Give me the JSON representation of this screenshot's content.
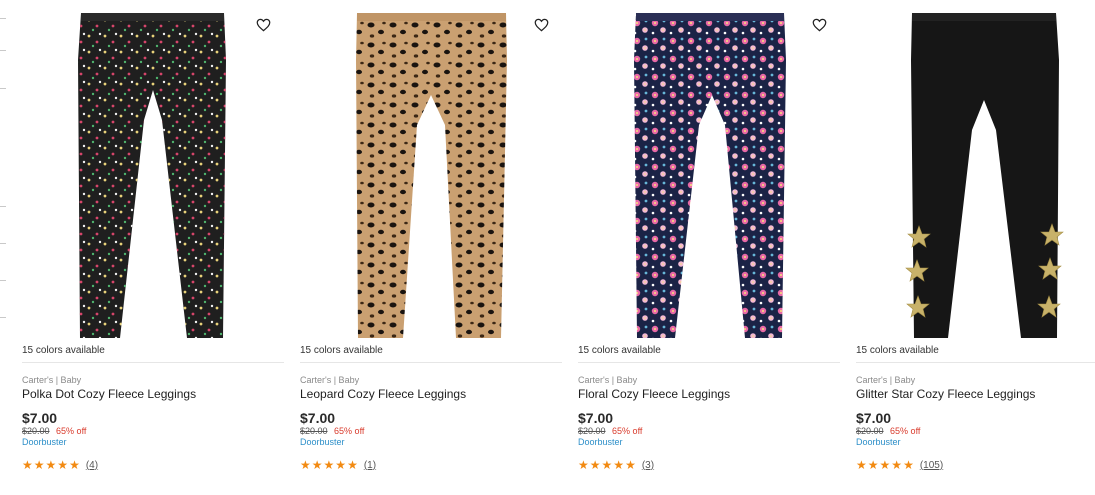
{
  "products": [
    {
      "colors_available": "15 colors available",
      "brand": "Carter's | Baby",
      "title": "Polka Dot Cozy Fleece Leggings",
      "price": "$7.00",
      "original_price": "$20.00",
      "discount": "65% off",
      "badge": "Doorbuster",
      "rating": 5,
      "review_count": "(4)",
      "favorite_icon": "heart-outline-icon"
    },
    {
      "colors_available": "15 colors available",
      "brand": "Carter's | Baby",
      "title": "Leopard Cozy Fleece Leggings",
      "price": "$7.00",
      "original_price": "$20.00",
      "discount": "65% off",
      "badge": "Doorbuster",
      "rating": 5,
      "review_count": "(1)",
      "favorite_icon": "heart-outline-icon"
    },
    {
      "colors_available": "15 colors available",
      "brand": "Carter's | Baby",
      "title": "Floral Cozy Fleece Leggings",
      "price": "$7.00",
      "original_price": "$20.00",
      "discount": "65% off",
      "badge": "Doorbuster",
      "rating": 5,
      "review_count": "(3)",
      "favorite_icon": "heart-outline-icon"
    },
    {
      "colors_available": "15 colors available",
      "brand": "Carter's | Baby",
      "title": "Glitter Star Cozy Fleece Leggings",
      "price": "$7.00",
      "original_price": "$20.00",
      "discount": "65% off",
      "badge": "Doorbuster",
      "rating": 5,
      "review_count": "(105)",
      "favorite_icon": "heart-outline-icon"
    }
  ],
  "colors": {
    "star": "#f28a12",
    "discount": "#d93a2b",
    "badge": "#2d8fc9"
  }
}
